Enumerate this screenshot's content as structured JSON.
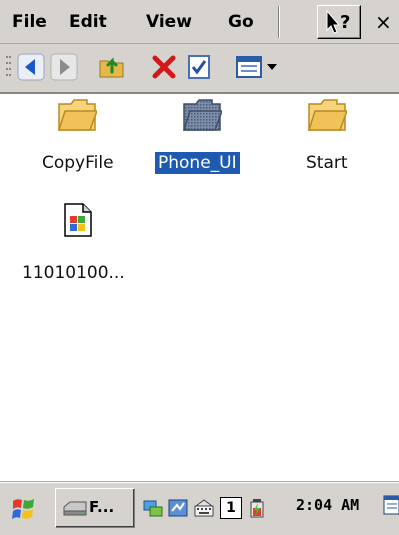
{
  "menu": {
    "file": "File",
    "edit": "Edit",
    "view": "View",
    "go": "Go",
    "help_icon": "help-pointer-icon",
    "close_glyph": "×"
  },
  "toolbar": {
    "back_icon": "back-arrow-icon",
    "forward_icon": "forward-arrow-icon",
    "up_icon": "up-folder-icon",
    "delete_icon": "delete-icon",
    "properties_icon": "properties-icon",
    "views_icon": "view-options-icon"
  },
  "files": [
    {
      "label": "CopyFile",
      "icon": "folder-icon",
      "selected": false
    },
    {
      "label": "Phone_UI",
      "icon": "folder-icon",
      "selected": true
    },
    {
      "label": "Start",
      "icon": "folder-icon",
      "selected": false
    },
    {
      "label": "11010100...",
      "icon": "file-icon",
      "selected": false
    }
  ],
  "taskbar": {
    "start_icon": "windows-start-icon",
    "task_label": "F...",
    "clock": "2:04 AM",
    "tray_number": "1"
  },
  "colors": {
    "chrome": "#d6d3ce",
    "selection": "#1e5bb0",
    "folder": "#f2c25a"
  }
}
